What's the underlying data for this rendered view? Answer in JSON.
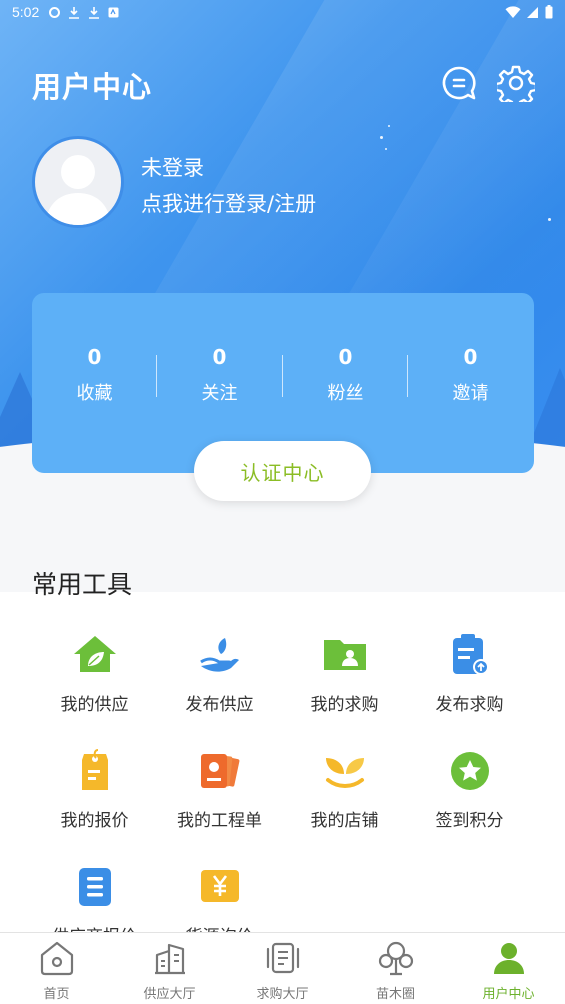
{
  "status_bar": {
    "time": "5:02"
  },
  "header": {
    "title": "用户中心"
  },
  "profile": {
    "line1": "未登录",
    "line2": "点我进行登录/注册"
  },
  "stats": [
    {
      "value": "0",
      "label": "收藏"
    },
    {
      "value": "0",
      "label": "关注"
    },
    {
      "value": "0",
      "label": "粉丝"
    },
    {
      "value": "0",
      "label": "邀请"
    }
  ],
  "cert_button": "认证中心",
  "tools": {
    "title": "常用工具",
    "items": [
      {
        "label": "我的供应",
        "icon": "house-leaf-icon"
      },
      {
        "label": "发布供应",
        "icon": "hand-plant-icon"
      },
      {
        "label": "我的求购",
        "icon": "folder-user-icon"
      },
      {
        "label": "发布求购",
        "icon": "clipboard-upload-icon"
      },
      {
        "label": "我的报价",
        "icon": "tag-icon"
      },
      {
        "label": "我的工程单",
        "icon": "cards-icon"
      },
      {
        "label": "我的店铺",
        "icon": "sprout-icon"
      },
      {
        "label": "签到积分",
        "icon": "star-badge-icon"
      },
      {
        "label": "供应商报价",
        "icon": "list-doc-icon"
      },
      {
        "label": "货源询价",
        "icon": "yen-ticket-icon"
      }
    ]
  },
  "nav": [
    {
      "label": "首页",
      "icon": "home-icon"
    },
    {
      "label": "供应大厅",
      "icon": "building-icon"
    },
    {
      "label": "求购大厅",
      "icon": "document-icon"
    },
    {
      "label": "苗木圈",
      "icon": "tree-icon"
    },
    {
      "label": "用户中心",
      "icon": "user-icon",
      "active": true
    }
  ],
  "colors": {
    "accent_green": "#6cb12c",
    "header_blue": "#3f95ee",
    "cert_text": "#8bbd25"
  }
}
